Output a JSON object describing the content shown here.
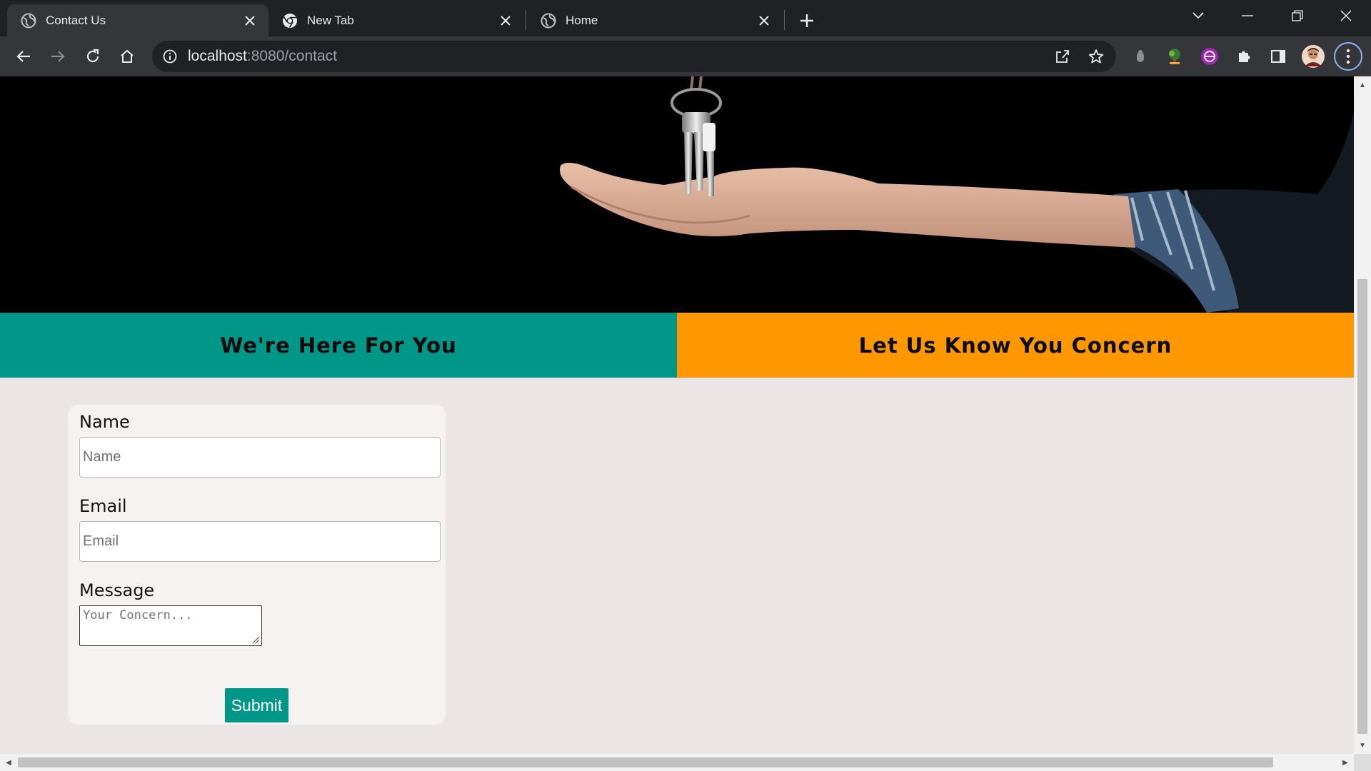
{
  "browser": {
    "tabs": [
      {
        "title": "Contact Us",
        "favicon": "globe-icon",
        "active": true
      },
      {
        "title": "New Tab",
        "favicon": "chrome-icon",
        "active": false
      },
      {
        "title": "Home",
        "favicon": "globe-icon",
        "active": false
      }
    ],
    "address": {
      "host": "localhost",
      "path": ":8080/contact"
    },
    "colors": {
      "frame": "#202124",
      "toolbar": "#35363a",
      "text": "#e8eaed"
    }
  },
  "page": {
    "banner_left": "We're Here For You",
    "banner_right": "Let Us Know You Concern",
    "colors": {
      "teal": "#009688",
      "orange": "#ff9800",
      "background": "#ebe5e5",
      "card": "#f6f2f1"
    },
    "form": {
      "name_label": "Name",
      "name_placeholder": "Name",
      "email_label": "Email",
      "email_placeholder": "Email",
      "message_label": "Message",
      "message_placeholder": "Your Concern...",
      "submit_label": "Submit"
    }
  }
}
